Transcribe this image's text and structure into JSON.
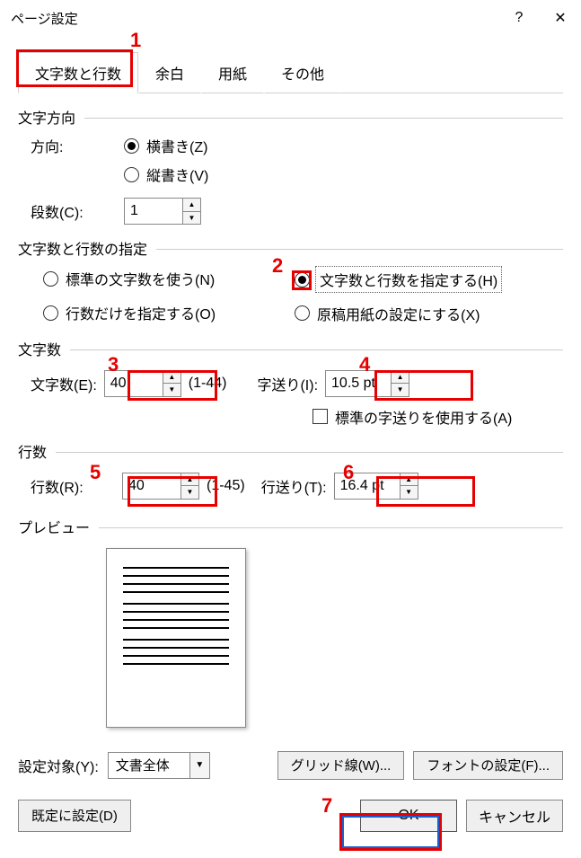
{
  "title": "ページ設定",
  "help": "?",
  "close": "✕",
  "tabs": [
    "文字数と行数",
    "余白",
    "用紙",
    "その他"
  ],
  "section1": {
    "title": "文字方向",
    "dir_label": "方向:",
    "horiz": "横書き(Z)",
    "vert": "縦書き(V)",
    "cols_label": "段数(C):",
    "cols_value": "1"
  },
  "section2": {
    "title": "文字数と行数の指定",
    "opt1": "標準の文字数を使う(N)",
    "opt2": "文字数と行数を指定する(H)",
    "opt3": "行数だけを指定する(O)",
    "opt4": "原稿用紙の設定にする(X)"
  },
  "section3": {
    "title": "文字数",
    "chars_label": "文字数(E):",
    "chars_value": "40",
    "chars_range": "(1-44)",
    "pitch_label": "字送り(I):",
    "pitch_value": "10.5 pt",
    "default_pitch": "標準の字送りを使用する(A)"
  },
  "section4": {
    "title": "行数",
    "lines_label": "行数(R):",
    "lines_value": "40",
    "lines_range": "(1-45)",
    "lpitch_label": "行送り(T):",
    "lpitch_value": "16.4 pt"
  },
  "preview_label": "プレビュー",
  "apply_label": "設定対象(Y):",
  "apply_value": "文書全体",
  "grid_btn": "グリッド線(W)...",
  "font_btn": "フォントの設定(F)...",
  "default_btn": "既定に設定(D)",
  "ok_btn": "OK",
  "cancel_btn": "キャンセル",
  "annotations": [
    "1",
    "2",
    "3",
    "4",
    "5",
    "6",
    "7"
  ]
}
